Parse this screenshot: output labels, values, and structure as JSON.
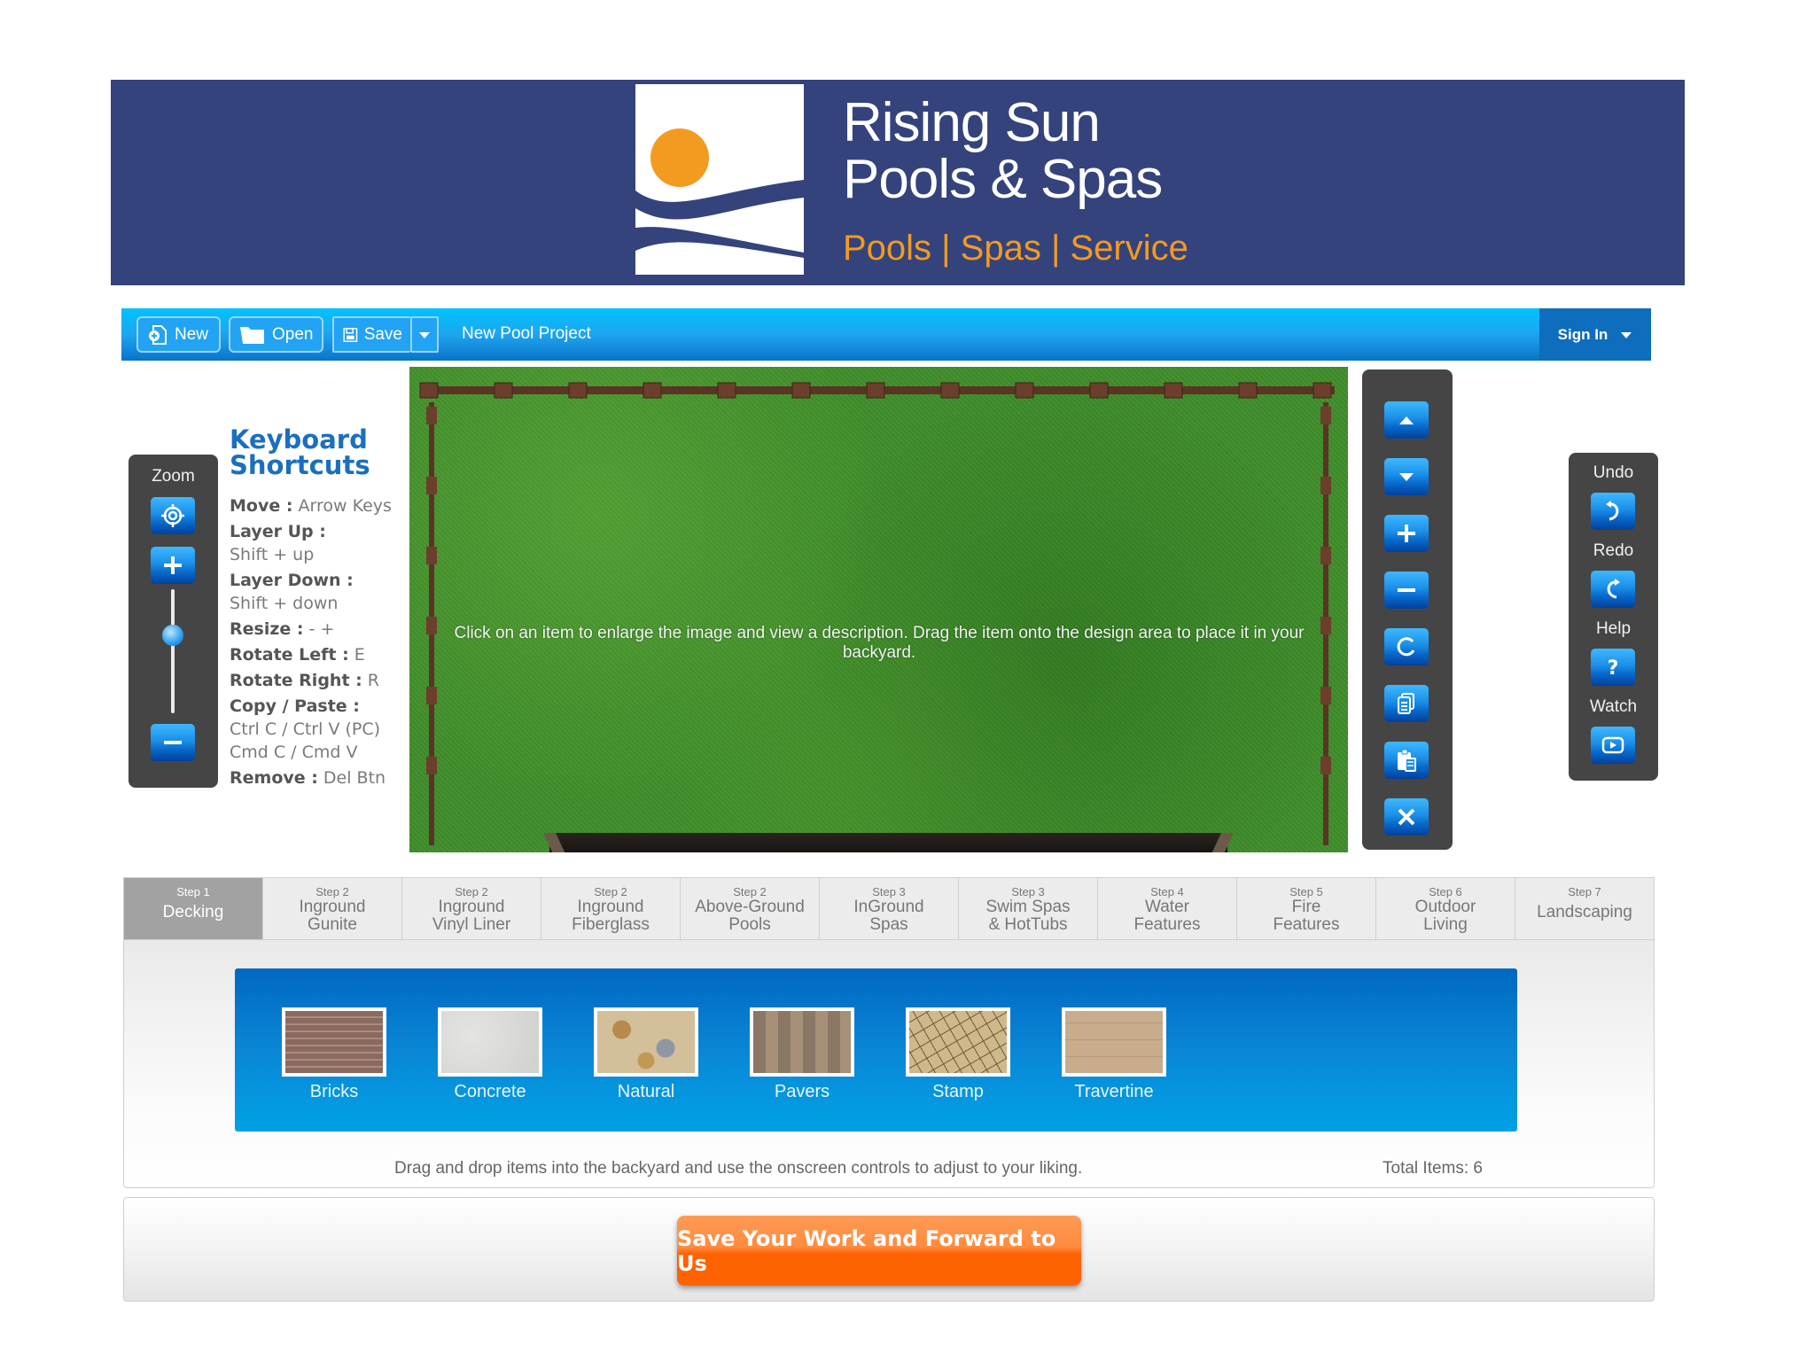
{
  "brand": {
    "name_line1": "Rising Sun",
    "name_line2": "Pools & Spas",
    "tagline": "Pools | Spas | Service",
    "colors": {
      "banner_bg": "#34437c",
      "sun": "#f39a21",
      "tagline": "#f39a21"
    }
  },
  "toolbar": {
    "new_label": "New",
    "open_label": "Open",
    "save_label": "Save",
    "project_name": "New Pool Project",
    "signin_label": "Sign In"
  },
  "zoom_panel": {
    "title": "Zoom",
    "level": 0.63,
    "buttons": [
      {
        "icon": "target-icon",
        "label": "Center"
      },
      {
        "icon": "plus-icon",
        "label": "Zoom In"
      },
      {
        "icon": "minus-icon",
        "label": "Zoom Out"
      }
    ]
  },
  "keyboard_shortcuts": {
    "title_line1": "Keyboard",
    "title_line2": "Shortcuts",
    "items": [
      {
        "key": "Move :",
        "value": "Arrow Keys"
      },
      {
        "key": "Layer Up :",
        "value": "Shift + up"
      },
      {
        "key": "Layer Down :",
        "value": "Shift + down"
      },
      {
        "key": "Resize :",
        "value": " - +"
      },
      {
        "key": "Rotate Left :",
        "value": "E"
      },
      {
        "key": "Rotate Right :",
        "value": "R"
      },
      {
        "key": "Copy / Paste :",
        "value": "Ctrl C / Ctrl V (PC)\nCmd C / Cmd V"
      },
      {
        "key": "Remove :",
        "value": "Del Btn"
      }
    ]
  },
  "canvas": {
    "hint": "Click on an item to enlarge the image and view a description. Drag the item onto the design area to place it in your backyard."
  },
  "object_controls": [
    {
      "icon": "layer-up-icon",
      "label": "Layer Up"
    },
    {
      "icon": "layer-down-icon",
      "label": "Layer Down"
    },
    {
      "icon": "plus-icon",
      "label": "Enlarge"
    },
    {
      "icon": "minus-icon",
      "label": "Shrink"
    },
    {
      "icon": "rotate-icon",
      "label": "Rotate"
    },
    {
      "icon": "copy-icon",
      "label": "Copy"
    },
    {
      "icon": "paste-icon",
      "label": "Paste"
    },
    {
      "icon": "delete-icon",
      "label": "Remove"
    }
  ],
  "history_panel": {
    "undo_label": "Undo",
    "redo_label": "Redo",
    "help_label": "Help",
    "watch_label": "Watch"
  },
  "steps": [
    {
      "num": "Step 1",
      "name": "Decking",
      "active": true
    },
    {
      "num": "Step 2",
      "name": "Inground\nGunite"
    },
    {
      "num": "Step 2",
      "name": "Inground\nVinyl Liner"
    },
    {
      "num": "Step 2",
      "name": "Inground\nFiberglass"
    },
    {
      "num": "Step 2",
      "name": "Above-Ground\nPools"
    },
    {
      "num": "Step 3",
      "name": "InGround\nSpas"
    },
    {
      "num": "Step 3",
      "name": "Swim Spas\n& HotTubs"
    },
    {
      "num": "Step 4",
      "name": "Water\nFeatures"
    },
    {
      "num": "Step 5",
      "name": "Fire\nFeatures"
    },
    {
      "num": "Step 6",
      "name": "Outdoor\nLiving"
    },
    {
      "num": "Step 7",
      "name": "Landscaping"
    }
  ],
  "items": [
    {
      "label": "Bricks",
      "swatch": "bricks"
    },
    {
      "label": "Concrete",
      "swatch": "concrete"
    },
    {
      "label": "Natural",
      "swatch": "natural"
    },
    {
      "label": "Pavers",
      "swatch": "pavers"
    },
    {
      "label": "Stamp",
      "swatch": "stamp"
    },
    {
      "label": "Travertine",
      "swatch": "travertine"
    }
  ],
  "items_footer": {
    "help": "Drag and drop items into the backyard and use the onscreen controls to adjust to your liking.",
    "total": "Total Items: 6"
  },
  "forward_button": {
    "label": "Save Your Work and Forward to Us",
    "color": "#ff6200"
  }
}
